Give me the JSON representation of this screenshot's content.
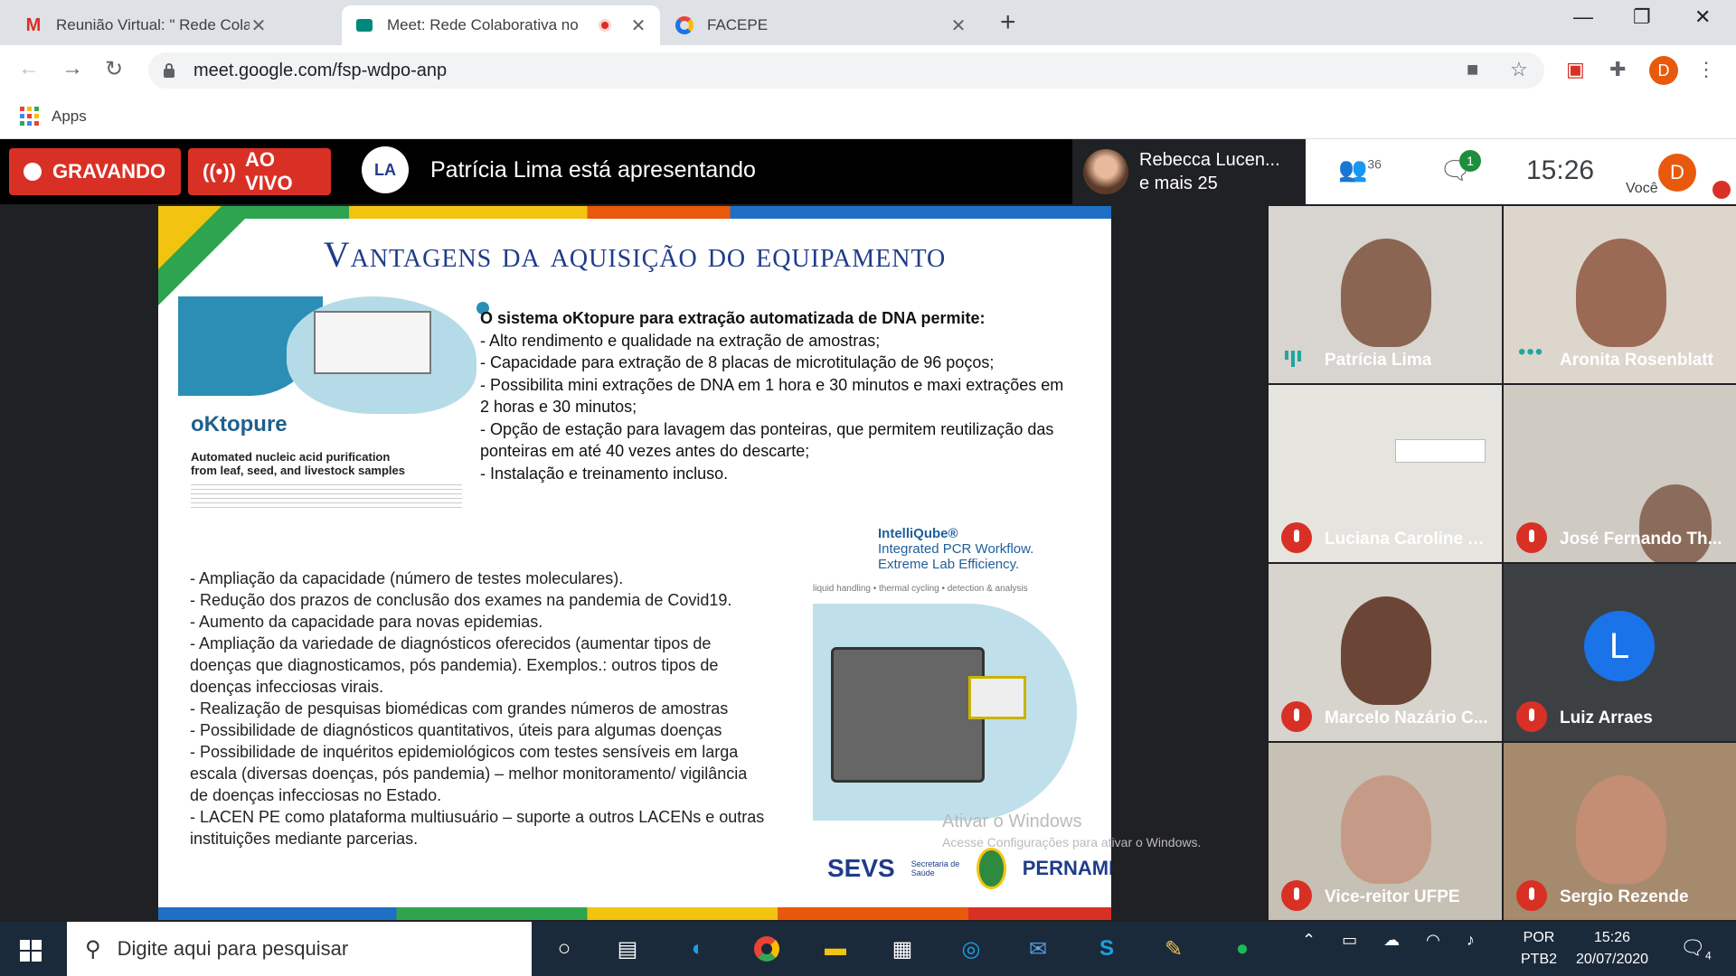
{
  "browser": {
    "tabs": [
      {
        "title": "Reunião Virtual: \" Rede Colabora",
        "icon": "gmail-icon"
      },
      {
        "title": "Meet: Rede Colaborativa no",
        "icon": "meet-icon",
        "recording": true
      },
      {
        "title": "FACEPE",
        "icon": "facepe-icon"
      }
    ],
    "url": "meet.google.com/fsp-wdpo-anp",
    "bookmarks": {
      "apps_label": "Apps"
    },
    "profile_initial": "D"
  },
  "meet": {
    "recording_label": "GRAVANDO",
    "live_label": "AO VIVO",
    "presenting_text": "Patrícia Lima está apresentando",
    "featured": {
      "line1": "Rebecca Lucen...",
      "line2": "e mais 25"
    },
    "participants_count": "36",
    "chat_badge": "1",
    "time": "15:26",
    "you_label": "Você",
    "you_initial": "D",
    "tiles": [
      {
        "name": "Patrícia Lima",
        "state": "speaking"
      },
      {
        "name": "Aronita Rosenblatt",
        "state": "active"
      },
      {
        "name": "Luciana Caroline Al...",
        "state": "muted"
      },
      {
        "name": "José Fernando Th...",
        "state": "muted"
      },
      {
        "name": "Marcelo Nazário C...",
        "state": "muted"
      },
      {
        "name": "Luiz Arraes",
        "state": "muted",
        "initial": "L"
      },
      {
        "name": "Vice-reitor UFPE",
        "state": "muted"
      },
      {
        "name": "Sergio Rezende",
        "state": "muted"
      }
    ]
  },
  "slide": {
    "title": "Vantagens da aquisição do equipamento",
    "oktopure": {
      "name": "oKtopure",
      "subtitle": "Automated nucleic acid purification from leaf, seed, and livestock samples"
    },
    "system_heading": "O sistema oKtopure para extração automatizada de DNA permite:",
    "system_items": [
      "- Alto rendimento e qualidade na extração de amostras;",
      "- Capacidade para extração de 8 placas de microtitulação de 96 poços;",
      "- Possibilita mini extrações de DNA em 1 hora e 30 minutos e maxi extrações em 2 horas e 30 minutos;",
      "- Opção de estação para lavagem das ponteiras, que permitem reutilização das ponteiras em até 40 vezes antes do descarte;",
      "- Instalação e treinamento incluso."
    ],
    "bullets": [
      "- Ampliação da capacidade (número de testes moleculares).",
      "- Redução dos prazos de conclusão dos exames na pandemia de Covid19.",
      "- Aumento da capacidade para novas epidemias.",
      "- Ampliação da variedade de diagnósticos oferecidos (aumentar tipos de doenças que diagnosticamos, pós pandemia). Exemplos.: outros tipos de doenças infecciosas virais.",
      "- Realização de pesquisas biomédicas com grandes números de amostras",
      "- Possibilidade de diagnósticos quantitativos, úteis para algumas doenças",
      "- Possibilidade de inquéritos epidemiológicos com testes sensíveis em larga escala (diversas doenças, pós pandemia) – melhor monitoramento/ vigilância de doenças infecciosas no Estado.",
      "- LACEN PE como plataforma multiusuário – suporte a outros LACENs e outras instituições mediante parcerias."
    ],
    "intelliqube": {
      "name": "IntelliQube®",
      "line2": "Integrated PCR Workflow.",
      "line3": "Extreme Lab Efficiency.",
      "arc_text": "liquid handling • thermal cycling • detection & analysis"
    },
    "logos": {
      "sevs": "SEVS",
      "secretaria": "Secretaria de Saúde",
      "pernambuco": "PERNAMBUCO"
    }
  },
  "watermark": {
    "line1": "Ativar o Windows",
    "line2": "Acesse Configurações para ativar o Windows."
  },
  "taskbar": {
    "search_placeholder": "Digite aqui para pesquisar",
    "lang1": "POR",
    "lang2": "PTB2",
    "time": "15:26",
    "date": "20/07/2020",
    "notif_count": "4"
  }
}
